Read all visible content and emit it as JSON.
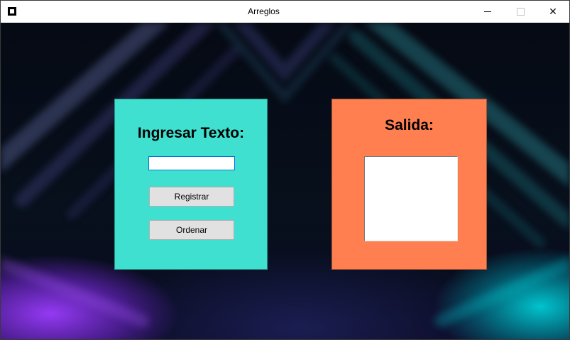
{
  "window": {
    "title": "Arreglos",
    "icon": "app-icon",
    "controls": [
      "minimize-icon",
      "maximize-icon",
      "close-icon"
    ],
    "close_glyph": "✕"
  },
  "input_panel": {
    "color": "#40e0d0",
    "heading": "Ingresar Texto:",
    "text_value": "",
    "register_button": "Registrar",
    "sort_button": "Ordenar"
  },
  "output_panel": {
    "color": "#ff7f50",
    "heading": "Salida:",
    "output_value": ""
  },
  "background": {
    "accent_left": "#9b3cff",
    "accent_right": "#00cdd7"
  }
}
